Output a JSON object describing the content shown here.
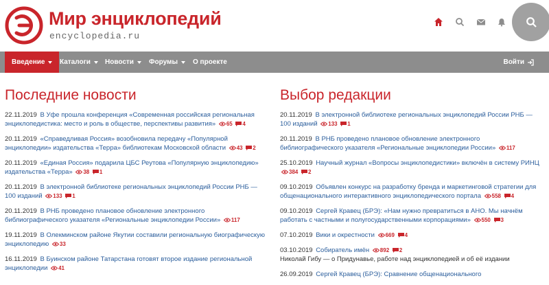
{
  "header": {
    "title": "Мир энциклопедий",
    "domain": "encyclopedia.ru",
    "icons": [
      "home-icon",
      "search-icon",
      "mail-icon",
      "bell-icon"
    ],
    "accent_color": "#c9252b"
  },
  "nav": {
    "items": [
      {
        "label": "Введение",
        "dropdown": true,
        "active": true
      },
      {
        "label": "Каталоги",
        "dropdown": true,
        "active": false
      },
      {
        "label": "Новости",
        "dropdown": true,
        "active": false
      },
      {
        "label": "Форумы",
        "dropdown": true,
        "active": false
      },
      {
        "label": "О проекте",
        "dropdown": false,
        "active": false
      }
    ],
    "login_label": "Войти"
  },
  "latest_news": {
    "title": "Последние новости",
    "items": [
      {
        "date": "22.11.2019",
        "text": "В Уфе прошла конференция «Современная российская региональная энциклопедистика: место и роль в обществе, перспективы развития»",
        "views": "65",
        "comments": "4"
      },
      {
        "date": "20.11.2019",
        "text": "«Справедливая Россия» возобновила передачу «Популярной энциклопедии» издательства «Терра» библиотекам Московской области",
        "views": "43",
        "comments": "2"
      },
      {
        "date": "20.11.2019",
        "text": "«Единая Россия» подарила ЦБС Реутова «Популярную энциклопедию» издательства «Терра»",
        "views": "38",
        "comments": "1"
      },
      {
        "date": "20.11.2019",
        "text": "В электронной библиотеке региональных энциклопедий России РНБ — 100 изданий",
        "views": "133",
        "comments": "1"
      },
      {
        "date": "20.11.2019",
        "text": "В РНБ проведено плановое обновление электронного библиографического указателя «Региональные энциклопедии России»",
        "views": "117",
        "comments": ""
      },
      {
        "date": "19.11.2019",
        "text": "В Олекминском районе Якутии составили региональную биографическую энциклопедию",
        "views": "33",
        "comments": ""
      },
      {
        "date": "16.11.2019",
        "text": "В Буинском районе Татарстана готовят второе издание региональной энциклопедии",
        "views": "41",
        "comments": ""
      }
    ]
  },
  "editors_choice": {
    "title": "Выбор редакции",
    "items": [
      {
        "date": "20.11.2019",
        "text": "В электронной библиотеке региональных энциклопедий России РНБ — 100 изданий",
        "views": "133",
        "comments": "1"
      },
      {
        "date": "20.11.2019",
        "text": "В РНБ проведено плановое обновление электронного библиографического указателя «Региональные энциклопедии России»",
        "views": "117",
        "comments": ""
      },
      {
        "date": "25.10.2019",
        "text": "Научный журнал «Вопросы энциклопедистики» включён в систему РИНЦ",
        "views": "384",
        "comments": "2"
      },
      {
        "date": "09.10.2019",
        "text": "Объявлен конкурс на разработку бренда и маркетинговой стратегии для общенационального интерактивного энциклопедического портала",
        "views": "558",
        "comments": "4"
      },
      {
        "date": "09.10.2019",
        "text": "Сергей Кравец (БРЭ): «Нам нужно превратиться в АНО. Мы начнём работать с частными и полугосударственными корпорациями»",
        "views": "550",
        "comments": "3"
      },
      {
        "date": "07.10.2019",
        "text": "Вики и окрестности",
        "views": "669",
        "comments": "4"
      },
      {
        "date": "03.10.2019",
        "text": "Собиратель имён",
        "views": "892",
        "comments": "2",
        "subtitle": "Николай Гибу — о Придунавье, работе над энциклопедией и об её издании"
      },
      {
        "date": "26.09.2019",
        "text": "Сергей Кравец (БРЭ): Сравнение общенационального",
        "views": "",
        "comments": ""
      }
    ]
  }
}
